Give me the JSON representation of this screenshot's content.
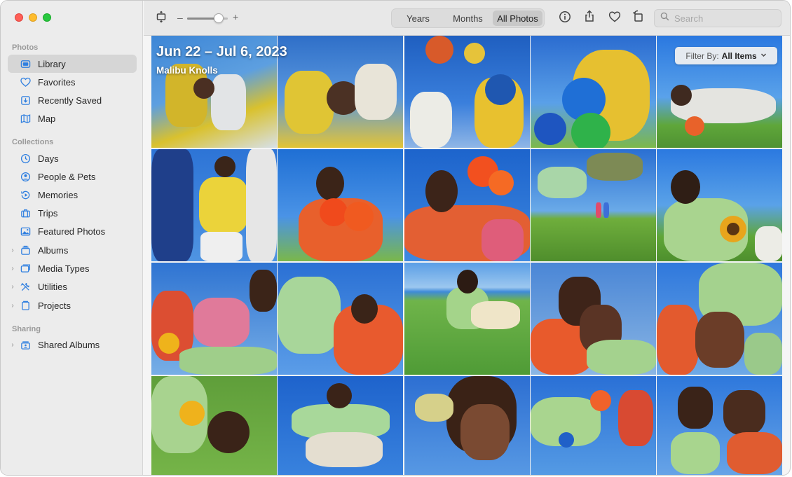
{
  "window": {
    "controls": [
      "close",
      "minimize",
      "maximize"
    ]
  },
  "sidebar": {
    "sections": [
      {
        "label": "Photos",
        "items": [
          {
            "label": "Library",
            "icon": "library-icon",
            "active": true
          },
          {
            "label": "Favorites",
            "icon": "heart-icon"
          },
          {
            "label": "Recently Saved",
            "icon": "recently-saved-icon"
          },
          {
            "label": "Map",
            "icon": "map-icon"
          }
        ]
      },
      {
        "label": "Collections",
        "items": [
          {
            "label": "Days",
            "icon": "clock-icon"
          },
          {
            "label": "People & Pets",
            "icon": "person-icon"
          },
          {
            "label": "Memories",
            "icon": "memories-icon"
          },
          {
            "label": "Trips",
            "icon": "suitcase-icon"
          },
          {
            "label": "Featured Photos",
            "icon": "photo-icon"
          },
          {
            "label": "Albums",
            "icon": "stack-icon",
            "expandable": true
          },
          {
            "label": "Media Types",
            "icon": "media-types-icon",
            "expandable": true
          },
          {
            "label": "Utilities",
            "icon": "tools-icon",
            "expandable": true
          },
          {
            "label": "Projects",
            "icon": "projects-icon",
            "expandable": true
          }
        ]
      },
      {
        "label": "Sharing",
        "items": [
          {
            "label": "Shared Albums",
            "icon": "shared-albums-icon",
            "expandable": true
          }
        ]
      }
    ]
  },
  "toolbar": {
    "zoom": {
      "minus_label": "–",
      "plus_label": "+",
      "level": 0.78
    },
    "view_tabs": [
      {
        "label": "Years"
      },
      {
        "label": "Months"
      },
      {
        "label": "All Photos",
        "active": true
      }
    ],
    "actions": [
      "info-icon",
      "share-icon",
      "favorite-heart-icon",
      "rotate-icon"
    ],
    "search": {
      "placeholder": "Search",
      "value": ""
    }
  },
  "library": {
    "date_range": "Jun 22 – Jul 6, 2023",
    "location": "Malibu Knolls",
    "filter": {
      "prefix": "Filter By:",
      "value": "All Items"
    }
  },
  "colors": {
    "sidebar_bg": "#ececec",
    "sidebar_selected": "#d6d6d6",
    "toolbar_bg": "#e8e8e8",
    "accent_blue": "#2f7fe0",
    "traffic_red": "#ff5f57",
    "traffic_yellow": "#febc2e",
    "traffic_green": "#28c840"
  }
}
